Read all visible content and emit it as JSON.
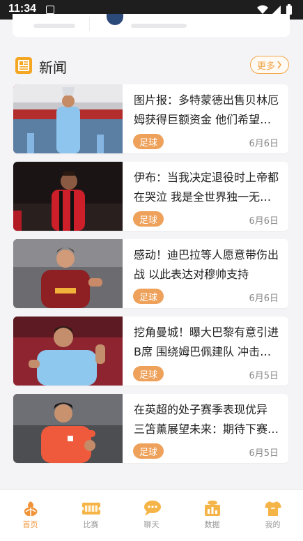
{
  "status_bar": {
    "time": "11:34"
  },
  "section": {
    "title": "新闻",
    "more_label": "更多"
  },
  "news": [
    {
      "title": "图片报：多特蒙德出售贝林厄姆获得巨额资金 他们希望签下新援",
      "tag": "足球",
      "date": "6月6日"
    },
    {
      "title": "伊布：当我决定退役时上帝都在哭泣 我是全世界独一无二的",
      "tag": "足球",
      "date": "6月6日"
    },
    {
      "title": "感动！迪巴拉等人愿意带伤出战 以此表达对穆帅支持",
      "tag": "足球",
      "date": "6月6日"
    },
    {
      "title": "挖角曼城！曝大巴黎有意引进B席 围绕姆巴佩建队 冲击欧冠",
      "tag": "足球",
      "date": "6月5日"
    },
    {
      "title": "在英超的处子赛季表现优异 三笘薰展望未来：期待下赛季更好",
      "tag": "足球",
      "date": "6月5日"
    }
  ],
  "tabs": [
    {
      "label": "首页",
      "icon": "home-basketball-icon"
    },
    {
      "label": "比赛",
      "icon": "match-ticket-icon"
    },
    {
      "label": "聊天",
      "icon": "chat-bubble-icon"
    },
    {
      "label": "数据",
      "icon": "data-chart-icon"
    },
    {
      "label": "我的",
      "icon": "profile-jersey-icon"
    }
  ],
  "colors": {
    "accent": "#f0943a",
    "tag_bg": "#eea15a",
    "background": "#f4f4f6"
  }
}
